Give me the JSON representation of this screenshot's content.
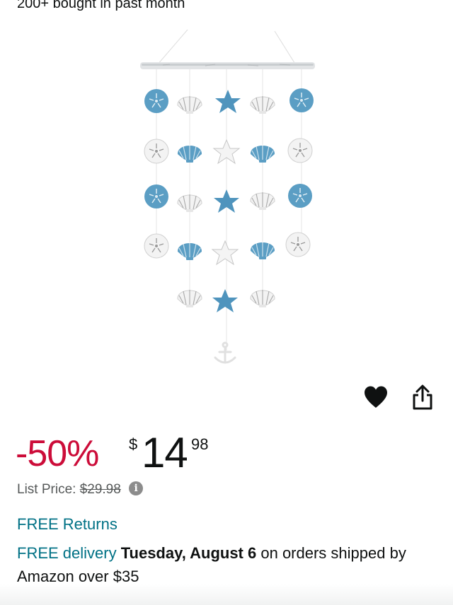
{
  "bought_badge": "200+ bought in past month",
  "product_image_alt": "",
  "actions": {
    "wishlist_icon": "heart-icon",
    "share_icon": "share-icon"
  },
  "price": {
    "discount": "-50%",
    "currency_symbol": "$",
    "whole": "14",
    "fraction": "98",
    "list_price_label": "List Price:",
    "list_price_value": "$29.98",
    "info_glyph": "i"
  },
  "free_returns": "FREE Returns",
  "delivery": {
    "free_label": "FREE delivery",
    "date": "Tuesday, August 6",
    "details": "on orders shipped by Amazon over $35"
  },
  "colors": {
    "discount": "#cc0c39",
    "link": "#007185",
    "text": "#0f1111",
    "muted": "#565959",
    "shell_blue": "#5b9ec4",
    "shell_white": "#f3f3f3"
  }
}
